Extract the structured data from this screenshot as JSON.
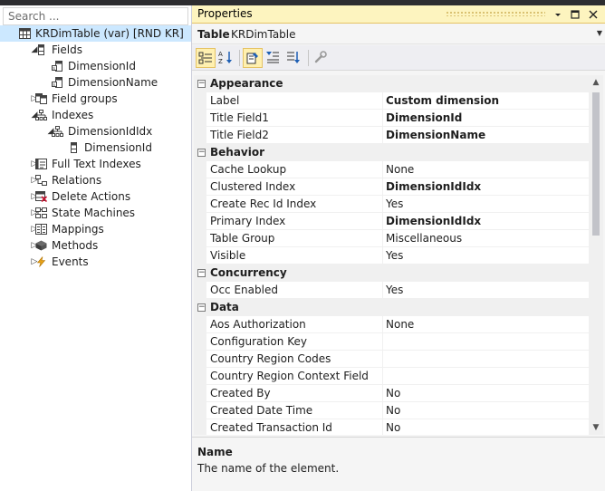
{
  "explorer": {
    "search_placeholder": "Search ...",
    "tree": [
      {
        "label": "KRDimTable (var) [RND KR]",
        "depth": 0,
        "toggle": "",
        "icon": "table",
        "selected": true
      },
      {
        "label": "Fields",
        "depth": 1,
        "toggle": "open",
        "icon": "field"
      },
      {
        "label": "DimensionId",
        "depth": 2,
        "toggle": "",
        "icon": "fieldstr"
      },
      {
        "label": "DimensionName",
        "depth": 2,
        "toggle": "",
        "icon": "fieldstr"
      },
      {
        "label": "Field groups",
        "depth": 1,
        "toggle": "closed",
        "icon": "fieldgroup"
      },
      {
        "label": "Indexes",
        "depth": 1,
        "toggle": "open",
        "icon": "index"
      },
      {
        "label": "DimensionIdIdx",
        "depth": 2,
        "toggle": "open",
        "icon": "index"
      },
      {
        "label": "DimensionId",
        "depth": 3,
        "toggle": "",
        "icon": "field"
      },
      {
        "label": "Full Text Indexes",
        "depth": 1,
        "toggle": "closed",
        "icon": "fulltext"
      },
      {
        "label": "Relations",
        "depth": 1,
        "toggle": "closed",
        "icon": "relation"
      },
      {
        "label": "Delete Actions",
        "depth": 1,
        "toggle": "closed",
        "icon": "deleteaction"
      },
      {
        "label": "State Machines",
        "depth": 1,
        "toggle": "closed",
        "icon": "statemachine"
      },
      {
        "label": "Mappings",
        "depth": 1,
        "toggle": "closed",
        "icon": "mapping"
      },
      {
        "label": "Methods",
        "depth": 1,
        "toggle": "closed",
        "icon": "method"
      },
      {
        "label": "Events",
        "depth": 1,
        "toggle": "closed",
        "icon": "event"
      }
    ]
  },
  "properties": {
    "title": "Properties",
    "object_kind": "Table",
    "object_name": "KRDimTable",
    "categories": [
      {
        "name": "Appearance",
        "props": [
          {
            "name": "Label",
            "value": "Custom dimension",
            "bold": true
          },
          {
            "name": "Title Field1",
            "value": "DimensionId",
            "bold": true
          },
          {
            "name": "Title Field2",
            "value": "DimensionName",
            "bold": true
          }
        ]
      },
      {
        "name": "Behavior",
        "props": [
          {
            "name": "Cache Lookup",
            "value": "None",
            "bold": false
          },
          {
            "name": "Clustered Index",
            "value": "DimensionIdIdx",
            "bold": true
          },
          {
            "name": "Create Rec Id Index",
            "value": "Yes",
            "bold": false
          },
          {
            "name": "Primary Index",
            "value": "DimensionIdIdx",
            "bold": true
          },
          {
            "name": "Table Group",
            "value": "Miscellaneous",
            "bold": false
          },
          {
            "name": "Visible",
            "value": "Yes",
            "bold": false
          }
        ]
      },
      {
        "name": "Concurrency",
        "props": [
          {
            "name": "Occ Enabled",
            "value": "Yes",
            "bold": false
          }
        ]
      },
      {
        "name": "Data",
        "props": [
          {
            "name": "Aos Authorization",
            "value": "None",
            "bold": false
          },
          {
            "name": "Configuration Key",
            "value": "",
            "bold": false
          },
          {
            "name": "Country Region Codes",
            "value": "",
            "bold": false
          },
          {
            "name": "Country Region Context Field",
            "value": "",
            "bold": false
          },
          {
            "name": "Created By",
            "value": "No",
            "bold": false
          },
          {
            "name": "Created Date Time",
            "value": "No",
            "bold": false
          },
          {
            "name": "Created Transaction Id",
            "value": "No",
            "bold": false
          }
        ]
      }
    ],
    "description": {
      "title": "Name",
      "text": "The name of the element."
    }
  }
}
